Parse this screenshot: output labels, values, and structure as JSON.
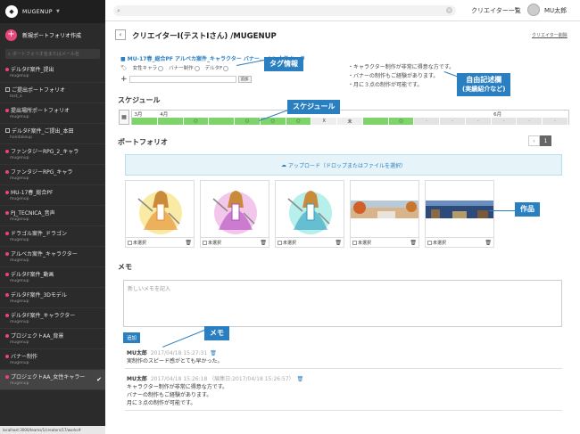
{
  "sidebar": {
    "brand": "MUGENUP",
    "new_portfolio": "新規ポートフォリオ作成",
    "search_placeholder": "ポートフォリオ名またはメール名",
    "items": [
      {
        "title": "デルタF案件_提出",
        "sub": "mugenup",
        "icon": "dot"
      },
      {
        "title": "ご提出ポートフォリオ",
        "sub": "test_a",
        "icon": "square"
      },
      {
        "title": "提出場所ポートフォリオ",
        "sub": "mugenup",
        "icon": "dot"
      },
      {
        "title": "デルタF案件_ご提出_本田",
        "sub": "hondakeup",
        "icon": "square"
      },
      {
        "title": "ファンタジーRPG_2_キャラ",
        "sub": "mugenup",
        "icon": "dot"
      },
      {
        "title": "ファンタジーRPG_キャラ",
        "sub": "mugenup",
        "icon": "dot"
      },
      {
        "title": "MU-17春_総合PF",
        "sub": "mugenup",
        "icon": "dot"
      },
      {
        "title": "PJ_TECNICA_音声",
        "sub": "mugenup",
        "icon": "dot"
      },
      {
        "title": "ドラゴル案件_ドラゴン",
        "sub": "mugenup",
        "icon": "dot"
      },
      {
        "title": "アルベカ案件_キャラクター",
        "sub": "mugenup",
        "icon": "dot"
      },
      {
        "title": "デルタF案件_動画",
        "sub": "mugenup",
        "icon": "dot"
      },
      {
        "title": "デルタF案件_3Dモデル",
        "sub": "mugenup",
        "icon": "dot"
      },
      {
        "title": "デルタF案件_キャラクター",
        "sub": "mugenup",
        "icon": "dot"
      },
      {
        "title": "プロジェクトAA_背景",
        "sub": "mugenup",
        "icon": "dot"
      },
      {
        "title": "バナー制作",
        "sub": "mugenup",
        "icon": "dot"
      },
      {
        "title": "プロジェクトAA_女性キャラー",
        "sub": "mugenup",
        "icon": "dot",
        "active": true
      }
    ],
    "status_url": "localhost:3000/teams/1/creators/17/works#"
  },
  "topbar": {
    "creators_link": "クリエイター一覧",
    "user_name": "MU太郎"
  },
  "page": {
    "title": "クリエイターI(テストIさん) /MUGENUP",
    "delete_link": "クリエイター削除",
    "folder_line": "MU-17春_総合PF アルベカ案件_キャラクター バナー... AA_女性キャラ",
    "tags": [
      "女性キャラ",
      "バナー制作",
      "デルタF"
    ],
    "tag_button": "追加",
    "free_text": [
      "・キャラクター制作が非常に得意な方です。",
      "・バナーの制作もご経験があります。",
      "・月に３点の制作が可能です。"
    ]
  },
  "schedule": {
    "title": "スケジュール",
    "months": [
      {
        "label": "3月",
        "cell": 0
      },
      {
        "label": "4月",
        "cell": 1
      },
      {
        "label": "6月",
        "cell": 14
      }
    ],
    "cells": [
      {
        "v": "",
        "s": "ok"
      },
      {
        "v": "",
        "s": "ok"
      },
      {
        "v": "○",
        "s": "ok"
      },
      {
        "v": "",
        "s": "ok"
      },
      {
        "v": "○",
        "s": "ok"
      },
      {
        "v": "○",
        "s": "ok"
      },
      {
        "v": "○",
        "s": "ok"
      },
      {
        "v": "X",
        "s": "x"
      },
      {
        "v": "未",
        "s": "x"
      },
      {
        "v": "",
        "s": "ok"
      },
      {
        "v": "○",
        "s": "ok"
      },
      {
        "v": "-",
        "s": "dash"
      },
      {
        "v": "-",
        "s": "dash"
      },
      {
        "v": "-",
        "s": "dash"
      },
      {
        "v": "-",
        "s": "dash"
      },
      {
        "v": "-",
        "s": "dash"
      },
      {
        "v": "-",
        "s": "dash"
      }
    ]
  },
  "portfolio": {
    "title": "ポートフォリオ",
    "page": "1",
    "upload": "アップロード（ドロップまたはファイルを選択）",
    "works": [
      {
        "label": "未選択",
        "kind": "girl-yellow"
      },
      {
        "label": "未選択",
        "kind": "girl-pink"
      },
      {
        "label": "未選択",
        "kind": "girl-cyan"
      },
      {
        "label": "未選択",
        "kind": "landscape-autumn"
      },
      {
        "label": "未選択",
        "kind": "landscape-night"
      }
    ]
  },
  "memo": {
    "title": "メモ",
    "placeholder": "新しいメモを記入",
    "add_button": "追加",
    "entries": [
      {
        "author": "MU太郎",
        "date": "2017/04/18 15:27:31",
        "lines": [
          "実制作のスピード感がとても早かった。"
        ]
      },
      {
        "author": "MU太郎",
        "date": "2017/04/18 15:26:18 （編集日:2017/04/18 15:26:57）",
        "lines": [
          "キャラクター制作が非常に得意な方です。",
          "バナーの制作もご経験があります。",
          "月に３点の制作が可能です。"
        ]
      }
    ]
  },
  "callouts": {
    "tag": "タグ情報",
    "free": [
      "自由記述欄",
      "(実績紹介など)"
    ],
    "schedule": "スケジュール",
    "works": "作品",
    "memo": "メモ"
  },
  "colors": {
    "accent": "#2a7fc1",
    "pink": "#e8457a",
    "ok": "#7ed36a",
    "sidebar": "#2b2b2b"
  }
}
